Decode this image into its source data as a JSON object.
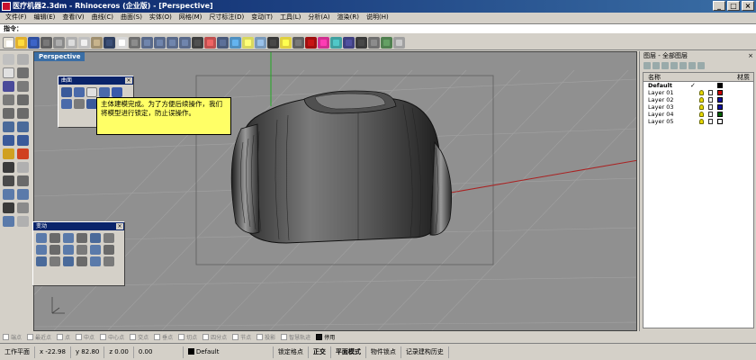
{
  "window": {
    "title": "医疗机器2.3dm - Rhinoceros (企业版) - [Perspective]"
  },
  "menu": [
    "文件(F)",
    "编辑(E)",
    "查看(V)",
    "曲线(C)",
    "曲面(S)",
    "实体(O)",
    "网格(M)",
    "尺寸标注(D)",
    "变动(T)",
    "工具(L)",
    "分析(A)",
    "渲染(R)",
    "说明(H)"
  ],
  "command": {
    "label": "指令："
  },
  "viewport": {
    "label": "Perspective"
  },
  "panels": {
    "surface": {
      "title": "曲面"
    },
    "transform": {
      "title": "变动"
    }
  },
  "callout": {
    "text": "主体建模完成。为了方便后续操作，我们将模型进行锁定，防止误操作。"
  },
  "layers": {
    "title": "图层 - 全部图层",
    "col_name": "名称",
    "col_material": "材质",
    "rows": [
      {
        "name": "Default",
        "current": true,
        "color": "#000000"
      },
      {
        "name": "Layer 01",
        "current": false,
        "color": "#cc0000"
      },
      {
        "name": "Layer 02",
        "current": false,
        "color": "#1010a0"
      },
      {
        "name": "Layer 03",
        "current": false,
        "color": "#1010a0"
      },
      {
        "name": "Layer 04",
        "current": false,
        "color": "#006000"
      },
      {
        "name": "Layer 05",
        "current": false,
        "color": "#ffffff"
      }
    ]
  },
  "snaps": [
    {
      "label": "端点",
      "on": false
    },
    {
      "label": "最近点",
      "on": false
    },
    {
      "label": "点",
      "on": false
    },
    {
      "label": "中点",
      "on": false
    },
    {
      "label": "中心点",
      "on": false
    },
    {
      "label": "交点",
      "on": false
    },
    {
      "label": "垂点",
      "on": false
    },
    {
      "label": "切点",
      "on": false
    },
    {
      "label": "四分点",
      "on": false
    },
    {
      "label": "节点",
      "on": false
    },
    {
      "label": "投影",
      "on": false
    },
    {
      "label": "智慧轨迹",
      "on": false
    },
    {
      "label": "停用",
      "on": true
    }
  ],
  "status": {
    "plane": "工作平面",
    "x": "x -22.98",
    "y": "y 82.80",
    "z": "z 0.00",
    "d": "0.00",
    "layer": "Default",
    "grid_snap": "锁定格点",
    "ortho": "正交",
    "planar": "平面模式",
    "object_snap": "物件锁点",
    "history": "记录建构历史"
  }
}
